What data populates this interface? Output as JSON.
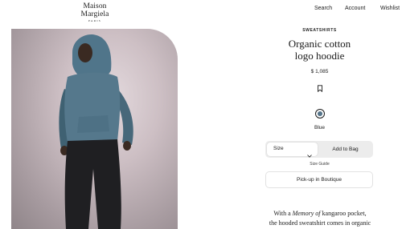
{
  "header": {
    "brand_name": "Maison Margiela",
    "brand_sub": "PARIS",
    "nav": {
      "search": "Search",
      "account": "Account",
      "wishlist": "Wishlist"
    }
  },
  "product": {
    "category": "SWEATSHIRTS",
    "title_line1": "Organic cotton",
    "title_line2": "logo hoodie",
    "price": "$ 1,085",
    "selected_color_name": "Blue",
    "swatch_color": "#55748a",
    "size_label": "Size",
    "add_to_bag_label": "Add to Bag",
    "size_guide_label": "Size Guide",
    "pickup_label": "Pick-up in Boutique",
    "description": {
      "line1_pre": "With a",
      "line1_emph": "Memory of",
      "line1_post": "kangaroo pocket,",
      "line2": "the hooded sweatshirt comes in organic"
    }
  },
  "icons": {
    "bookmark": "bookmark-icon",
    "chevron": "chevron-down-icon"
  }
}
